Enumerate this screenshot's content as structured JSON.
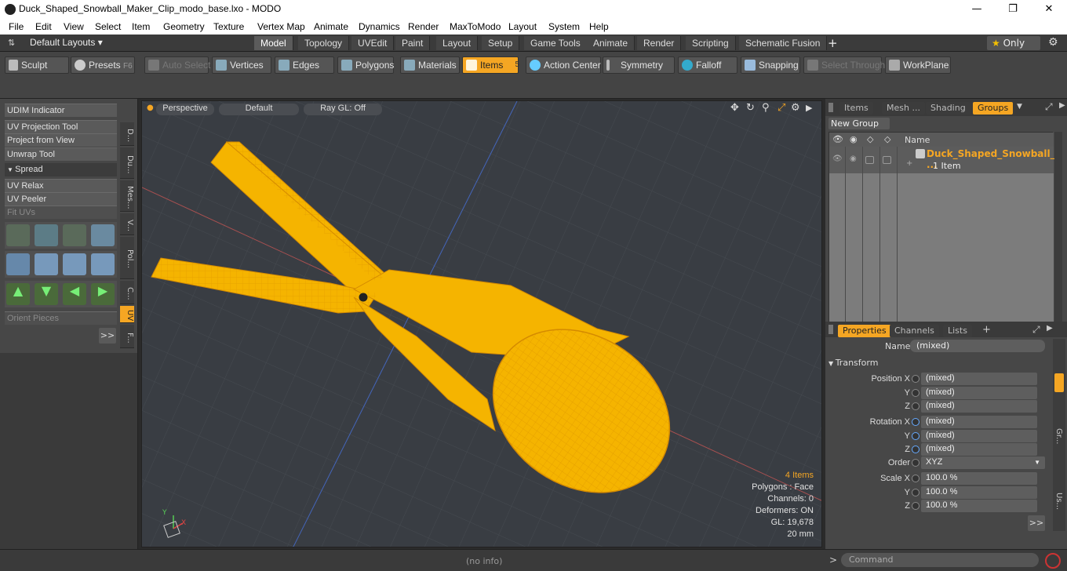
{
  "window": {
    "title": "Duck_Shaped_Snowball_Maker_Clip_modo_base.lxo - MODO",
    "minimize": "—",
    "maximize": "❐",
    "close": "✕"
  },
  "menu": [
    "File",
    "Edit",
    "View",
    "Select",
    "Item",
    "Geometry",
    "Texture",
    "Vertex Map",
    "Animate",
    "Dynamics",
    "Render",
    "MaxToModo",
    "Layout",
    "System",
    "Help"
  ],
  "layout": {
    "preset": "Default Layouts ▾",
    "tabs": [
      "Model",
      "Topology",
      "UVEdit",
      "Paint",
      "Layout",
      "Setup",
      "Game Tools",
      "Animate",
      "Render",
      "Scripting",
      "Schematic Fusion"
    ],
    "active_tab": "Model",
    "plus": "+",
    "only": "Only"
  },
  "toolbar": {
    "sculpt": "Sculpt",
    "presets": "Presets",
    "presets_key": "F6",
    "auto_select": "Auto Select",
    "vertices": "Vertices",
    "vertices_n": "1",
    "edges": "Edges",
    "edges_n": "2",
    "polygons": "Polygons",
    "materials": "Materials",
    "items": "Items",
    "items_n": "5",
    "action_center": "Action Center",
    "symmetry": "Symmetry",
    "falloff": "Falloff",
    "snapping": "Snapping",
    "select_through": "Select Through",
    "workplane": "WorkPlane"
  },
  "left": {
    "udim": "UDIM Indicator",
    "uv_projection": "UV Projection Tool",
    "project_view": "Project from View",
    "unwrap": "Unwrap Tool",
    "spread": "Spread",
    "uv_relax": "UV Relax",
    "uv_peeler": "UV Peeler",
    "fit_uvs": "Fit UVs",
    "orient": "Orient Pieces",
    "more": ">>",
    "vtabs": [
      "D...",
      "Du...",
      "Mes...",
      "V...",
      "Pol...",
      "C...",
      "UV",
      "F..."
    ]
  },
  "viewport": {
    "view": "Perspective",
    "shading": "Default",
    "raygl": "Ray GL: Off",
    "hud": {
      "items": "4 Items",
      "polygons": "Polygons : Face",
      "channels": "Channels: 0",
      "deformers": "Deformers: ON",
      "gl": "GL: 19,678",
      "scale": "20 mm"
    },
    "colors": {
      "mesh": "#f5b400",
      "wire": "#d48a00",
      "bg": "#393d43"
    }
  },
  "groups": {
    "tabs": [
      "Items",
      "Mesh ...",
      "Shading",
      "Groups"
    ],
    "active": "Groups",
    "new_group": "New Group",
    "col_name": "Name",
    "item_name": "Duck_Shaped_Snowball_ ...",
    "item_count": "1 Item"
  },
  "properties": {
    "tabs": [
      "Properties",
      "Channels",
      "Lists"
    ],
    "plus": "+",
    "name_label": "Name",
    "name_value": "(mixed)",
    "transform": "Transform",
    "rows": [
      {
        "label": "Position X",
        "value": "(mixed)"
      },
      {
        "label": "Y",
        "value": "(mixed)"
      },
      {
        "label": "Z",
        "value": "(mixed)"
      },
      {
        "label": "Rotation X",
        "value": "(mixed)"
      },
      {
        "label": "Y",
        "value": "(mixed)"
      },
      {
        "label": "Z",
        "value": "(mixed)"
      },
      {
        "label": "Order",
        "value": "XYZ"
      },
      {
        "label": "Scale X",
        "value": "100.0 %"
      },
      {
        "label": "Y",
        "value": "100.0 %"
      },
      {
        "label": "Z",
        "value": "100.0 %"
      }
    ],
    "more": ">>",
    "side_tabs": [
      "Gr...",
      "Us..."
    ]
  },
  "status": {
    "info": "(no info)",
    "command": "Command",
    "prompt": ">"
  }
}
